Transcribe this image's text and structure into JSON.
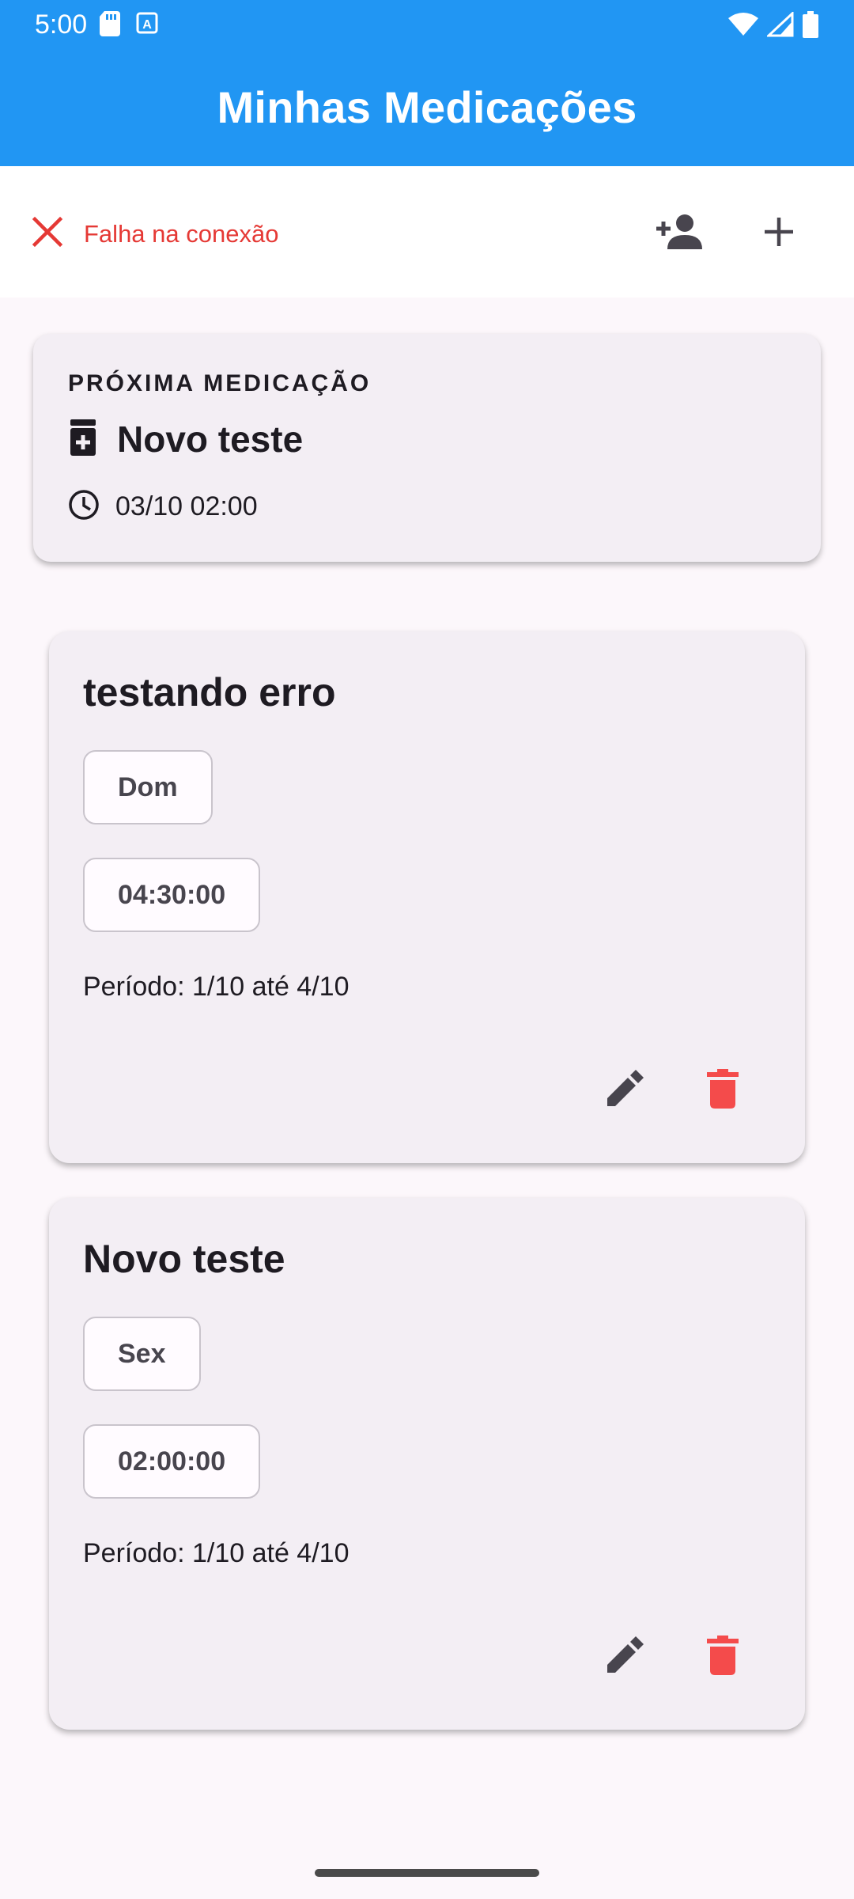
{
  "status_bar": {
    "time": "5:00",
    "icons": [
      "sd-card-icon",
      "keyboard-a-icon",
      "wifi-icon",
      "signal-icon",
      "battery-icon"
    ]
  },
  "app_bar": {
    "title": "Minhas Medicações"
  },
  "toolbar": {
    "connection_status": "Falha na conexão",
    "connection_icon": "close-icon",
    "add_person_icon": "add-person-icon",
    "add_icon": "add-icon"
  },
  "next_medication": {
    "label": "PRÓXIMA MEDICAÇÃO",
    "name": "Novo teste",
    "time": "03/10 02:00"
  },
  "medications": [
    {
      "name": "testando erro",
      "day": "Dom",
      "time": "04:30:00",
      "period": "Período: 1/10 até 4/10"
    },
    {
      "name": "Novo teste",
      "day": "Sex",
      "time": "02:00:00",
      "period": "Período: 1/10 até 4/10"
    }
  ],
  "colors": {
    "primary": "#2196F3",
    "error": "#E53935",
    "delete": "#F44B4B",
    "card": "#F3EEF4",
    "background": "#FCF7FB"
  }
}
